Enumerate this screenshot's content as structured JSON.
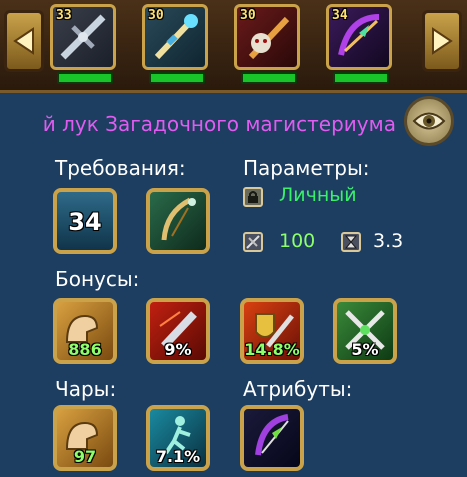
{
  "top_bar": {
    "slots": [
      {
        "level": "33",
        "icon": "crossbow-icon"
      },
      {
        "level": "30",
        "icon": "staff-icon"
      },
      {
        "level": "30",
        "icon": "demon-sword-icon"
      },
      {
        "level": "34",
        "icon": "magic-bow-icon"
      }
    ]
  },
  "item": {
    "title": "й лук Загадочного магистериума"
  },
  "requirements": {
    "label": "Требования:",
    "level": "34"
  },
  "parameters": {
    "label": "Параметры:",
    "binding": "Личный",
    "stat1_value": "100",
    "stat2_value": "3.3"
  },
  "bonuses": {
    "label": "Бонусы:",
    "items": [
      {
        "value": "886",
        "icon": "strength-arm-icon"
      },
      {
        "value": "9%",
        "icon": "critical-blade-icon"
      },
      {
        "value": "14.8%",
        "icon": "sword-shield-icon"
      },
      {
        "value": "5%",
        "icon": "crossed-swords-icon"
      }
    ]
  },
  "enchantments": {
    "label": "Чары:",
    "items": [
      {
        "value": "97",
        "icon": "strength-arm-icon"
      },
      {
        "value": "7.1%",
        "icon": "dodge-figure-icon"
      }
    ]
  },
  "attributes": {
    "label": "Атрибуты:",
    "icon": "bow-attribute-icon"
  },
  "colors": {
    "title": "#e05cf0",
    "binding": "#38f06a",
    "stat_value": "#8cff6a",
    "frame": "#c9a24a",
    "panel": "#1d3e61"
  }
}
